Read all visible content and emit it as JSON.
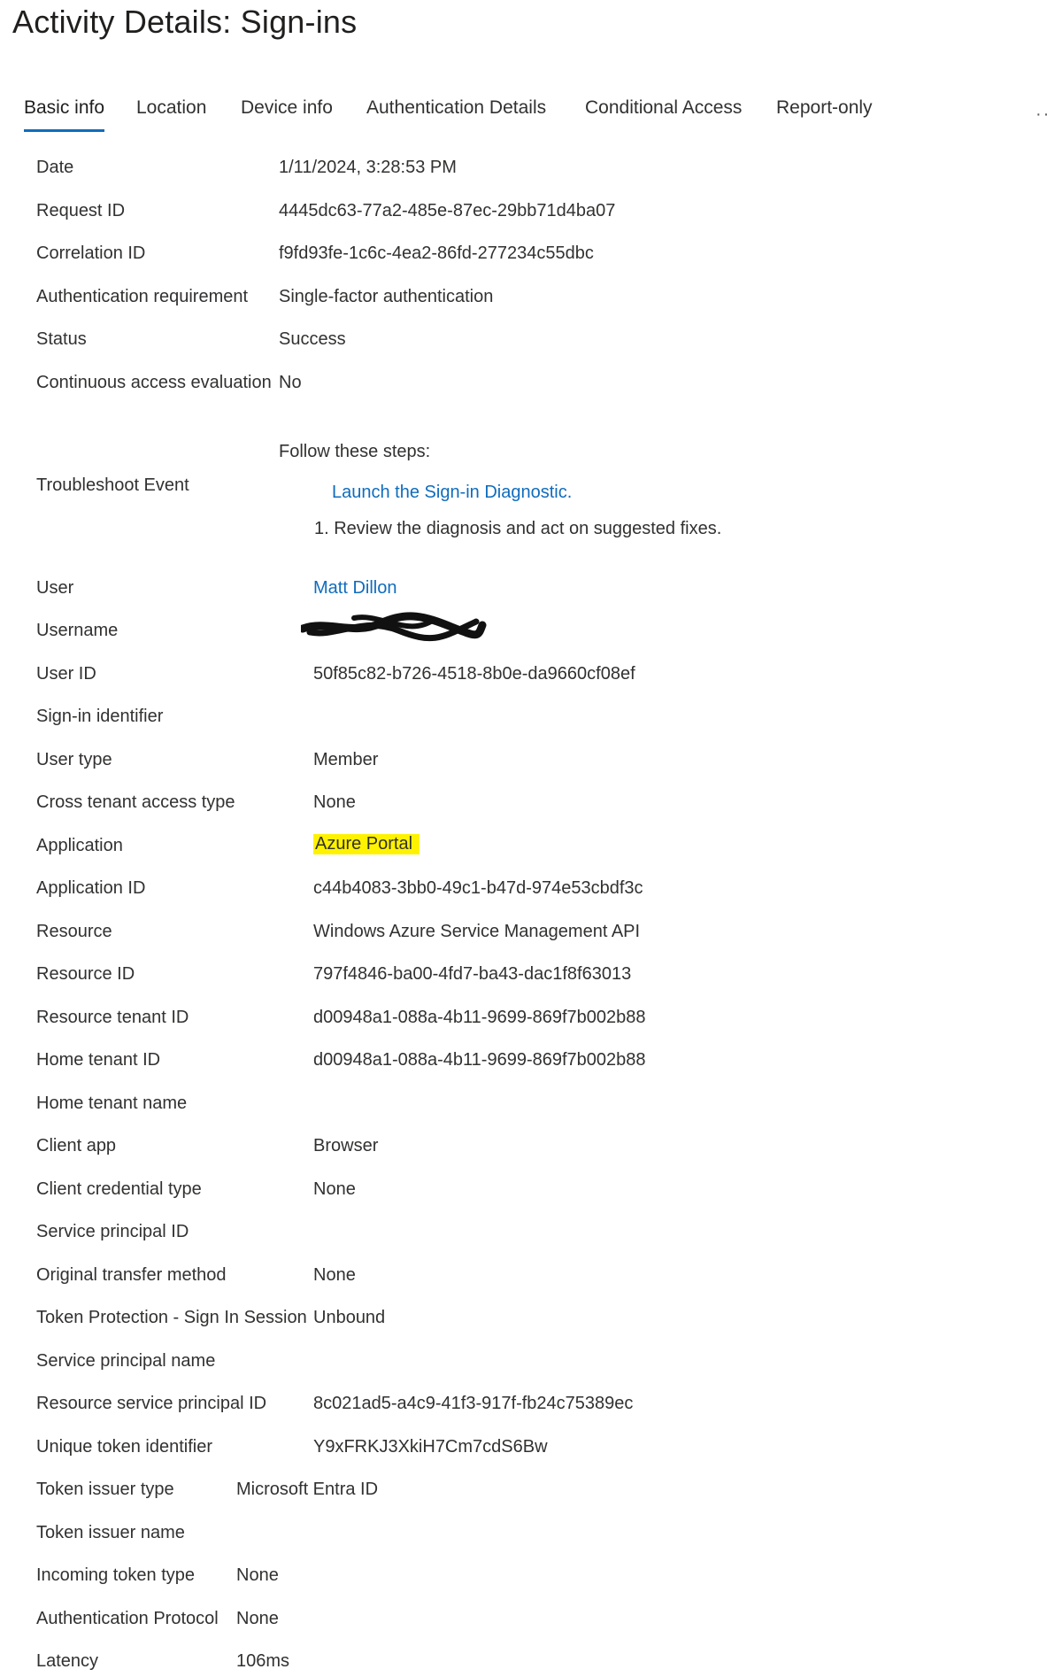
{
  "page_title": "Activity Details: Sign-ins",
  "tabs": [
    {
      "label": "Basic info",
      "active": true
    },
    {
      "label": "Location"
    },
    {
      "label": "Device info"
    },
    {
      "label": "Authentication Details"
    },
    {
      "label": "Conditional Access"
    },
    {
      "label": "Report-only"
    }
  ],
  "tab_more": "··",
  "colors": {
    "link": "#0f6cbd",
    "highlight": "#fff200",
    "active_tab_underline": "#0f6cbd"
  },
  "details": {
    "date": {
      "label": "Date",
      "value": "1/11/2024, 3:28:53 PM"
    },
    "request_id": {
      "label": "Request ID",
      "value": "4445dc63-77a2-485e-87ec-29bb71d4ba07"
    },
    "correlation_id": {
      "label": "Correlation ID",
      "value": "f9fd93fe-1c6c-4ea2-86fd-277234c55dbc"
    },
    "auth_requirement": {
      "label": "Authentication requirement",
      "value": "Single-factor authentication"
    },
    "status": {
      "label": "Status",
      "value": "Success"
    },
    "cae": {
      "label": "Continuous access evaluation",
      "value": "No"
    },
    "troubleshoot": {
      "label": "Troubleshoot Event",
      "intro": "Follow these steps:",
      "link": "Launch the Sign-in Diagnostic.",
      "step": "1. Review the diagnosis and act on suggested fixes."
    },
    "user": {
      "label": "User",
      "value": "Matt Dillon"
    },
    "username": {
      "label": "Username",
      "value": ""
    },
    "user_id": {
      "label": "User ID",
      "value": "50f85c82-b726-4518-8b0e-da9660cf08ef"
    },
    "signin_identifier": {
      "label": "Sign-in identifier",
      "value": ""
    },
    "user_type": {
      "label": "User type",
      "value": "Member"
    },
    "cross_tenant": {
      "label": "Cross tenant access type",
      "value": "None"
    },
    "application": {
      "label": "Application",
      "value": "Azure Portal"
    },
    "application_id": {
      "label": "Application ID",
      "value": "c44b4083-3bb0-49c1-b47d-974e53cbdf3c"
    },
    "resource": {
      "label": "Resource",
      "value": "Windows Azure Service Management API"
    },
    "resource_id": {
      "label": "Resource ID",
      "value": "797f4846-ba00-4fd7-ba43-dac1f8f63013"
    },
    "resource_tenant_id": {
      "label": "Resource tenant ID",
      "value": "d00948a1-088a-4b11-9699-869f7b002b88"
    },
    "home_tenant_id": {
      "label": "Home tenant ID",
      "value": "d00948a1-088a-4b11-9699-869f7b002b88"
    },
    "home_tenant_name": {
      "label": "Home tenant name",
      "value": ""
    },
    "client_app": {
      "label": "Client app",
      "value": "Browser"
    },
    "client_credential_type": {
      "label": "Client credential type",
      "value": "None"
    },
    "service_principal_id": {
      "label": "Service principal ID",
      "value": ""
    },
    "original_transfer_method": {
      "label": "Original transfer method",
      "value": "None"
    },
    "token_protection": {
      "label": "Token Protection - Sign In Session",
      "value": "Unbound"
    },
    "service_principal_name": {
      "label": "Service principal name",
      "value": ""
    },
    "resource_sp_id": {
      "label": "Resource service principal ID",
      "value": "8c021ad5-a4c9-41f3-917f-fb24c75389ec"
    },
    "unique_token_id": {
      "label": "Unique token identifier",
      "value": "Y9xFRKJ3XkiH7Cm7cdS6Bw"
    },
    "token_issuer_type": {
      "label": "Token issuer type",
      "value": "Microsoft Entra ID"
    },
    "token_issuer_name": {
      "label": "Token issuer name",
      "value": ""
    },
    "incoming_token_type": {
      "label": "Incoming token type",
      "value": "None"
    },
    "auth_protocol": {
      "label": "Authentication Protocol",
      "value": "None"
    },
    "latency": {
      "label": "Latency",
      "value": "106ms"
    }
  }
}
